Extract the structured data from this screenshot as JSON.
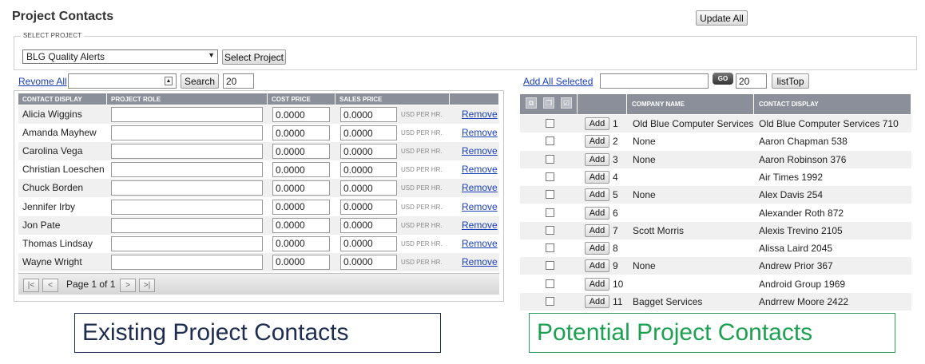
{
  "header": {
    "title": "Project Contacts",
    "update_all_label": "Update All"
  },
  "select_project": {
    "legend": "SELECT PROJECT",
    "selected": "BLG Quality Alerts",
    "button_label": "Select Project"
  },
  "left": {
    "remove_all_label": "Revome All",
    "search_value": "",
    "search_label": "Search",
    "count": "20",
    "columns": [
      "CONTACT DISPLAY",
      "PROJECT ROLE",
      "COST PRICE",
      "SALES PRICE",
      ""
    ],
    "unit": "USD PER HR.",
    "remove_label": "Remove",
    "rows": [
      {
        "name": "Alicia Wiggins",
        "role": "",
        "cost": "0.0000",
        "sales": "0.0000"
      },
      {
        "name": "Amanda Mayhew",
        "role": "",
        "cost": "0.0000",
        "sales": "0.0000"
      },
      {
        "name": "Carolina Vega",
        "role": "",
        "cost": "0.0000",
        "sales": "0.0000"
      },
      {
        "name": "Christian Loeschen",
        "role": "",
        "cost": "0.0000",
        "sales": "0.0000"
      },
      {
        "name": "Chuck Borden",
        "role": "",
        "cost": "0.0000",
        "sales": "0.0000"
      },
      {
        "name": "Jennifer Irby",
        "role": "",
        "cost": "0.0000",
        "sales": "0.0000"
      },
      {
        "name": "Jon Pate",
        "role": "",
        "cost": "0.0000",
        "sales": "0.0000"
      },
      {
        "name": "Thomas Lindsay",
        "role": "",
        "cost": "0.0000",
        "sales": "0.0000"
      },
      {
        "name": "Wayne Wright",
        "role": "",
        "cost": "0.0000",
        "sales": "0.0000"
      }
    ],
    "pager": {
      "label": "Page 1 of 1",
      "first": "|<",
      "prev": "<",
      "next": ">",
      "last": ">|"
    }
  },
  "right": {
    "add_all_selected_label": "Add All Selected",
    "search_value": "",
    "go_label": "GO",
    "count": "20",
    "listtop_label": "listTop",
    "columns": [
      "",
      "",
      "COMPANY NAME",
      "CONTACT DISPLAY"
    ],
    "add_label": "Add",
    "rows": [
      {
        "num": "1",
        "company": "Old Blue Computer Services",
        "contact": "Old Blue Computer Services 710"
      },
      {
        "num": "2",
        "company": "None",
        "contact": "Aaron Chapman 538"
      },
      {
        "num": "3",
        "company": "None",
        "contact": "Aaron Robinson 376"
      },
      {
        "num": "4",
        "company": "",
        "contact": "Air Times 1992"
      },
      {
        "num": "5",
        "company": "None",
        "contact": "Alex Davis 254"
      },
      {
        "num": "6",
        "company": "",
        "contact": "Alexander Roth 872"
      },
      {
        "num": "7",
        "company": "Scott Morris",
        "contact": "Alexis Trevino 2105"
      },
      {
        "num": "8",
        "company": "",
        "contact": "Alissa Laird 2045"
      },
      {
        "num": "9",
        "company": "None",
        "contact": "Andrew Prior 367"
      },
      {
        "num": "10",
        "company": "",
        "contact": "Android Group 1969"
      },
      {
        "num": "11",
        "company": "Bagget Services",
        "contact": "Andrrew Moore 2422"
      }
    ]
  },
  "labels": {
    "existing": "Existing Project Contacts",
    "potential": "Potential Project Contacts"
  },
  "colors": {
    "header_bg": "#8a8f9a",
    "link": "#1a3fb8",
    "existing_label": "#1f2d4f",
    "potential_label": "#1ea053"
  }
}
